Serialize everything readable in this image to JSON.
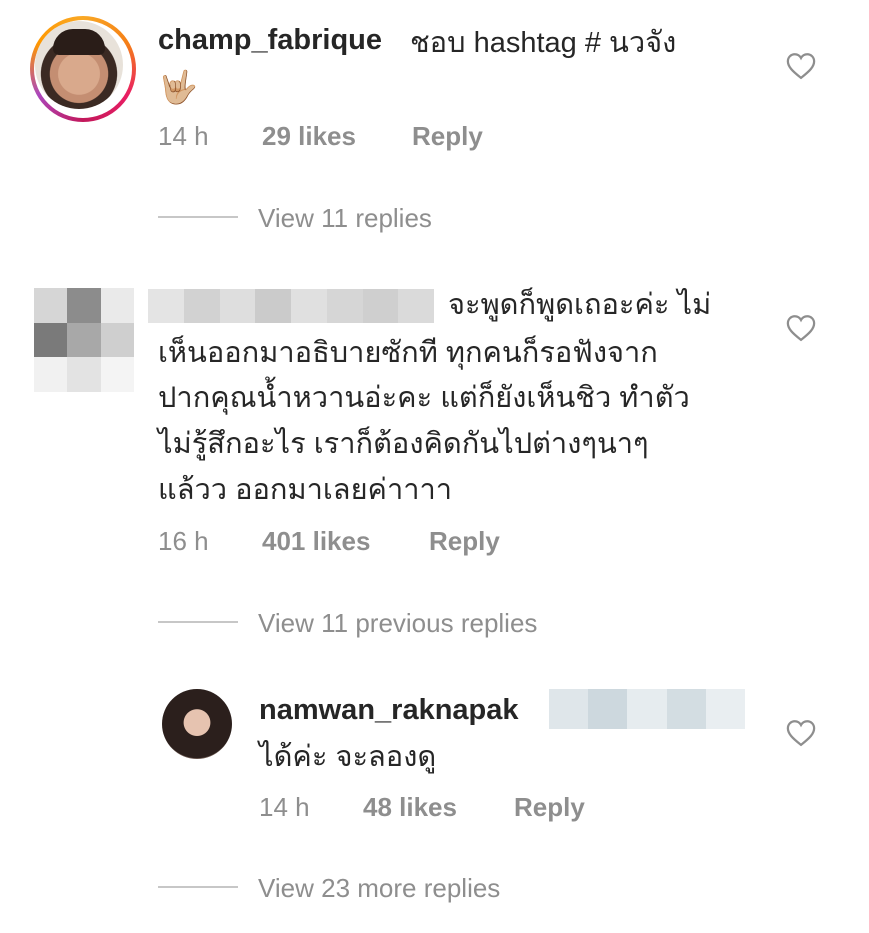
{
  "comments": [
    {
      "username": "champ_fabrique",
      "text": "ชอบ hashtag # นวจัง",
      "emoji": "🤟🏼",
      "time": "14 h",
      "likes": "29 likes",
      "reply": "Reply",
      "view_replies": "View 11 replies"
    },
    {
      "username_obscured": true,
      "text_lines": [
        "จะพูดก็พูดเถอะค่ะ ไม่",
        "เห็นออกมาอธิบายซักที ทุกคนก็รอฟังจาก",
        "ปากคุณน้ำหวานอ่ะคะ แต่ก็ยังเห็นชิว ทำตัว",
        "ไม่รู้สึกอะไร เราก็ต้องคิดกันไปต่างๆนาๆ",
        "แล้วว ออกมาเลยค่าาาา"
      ],
      "time": "16 h",
      "likes": "401 likes",
      "reply": "Reply",
      "view_replies": "View 11 previous replies"
    },
    {
      "username": "namwan_raknapak",
      "text": "ได้ค่ะ จะลองดู",
      "time": "14 h",
      "likes": "48 likes",
      "reply": "Reply",
      "view_replies": "View 23 more replies"
    }
  ],
  "icons": {
    "like": "heart-outline-icon"
  },
  "colors": {
    "text": "#262626",
    "meta": "#8e8e8e",
    "line": "#c7c7c7"
  }
}
